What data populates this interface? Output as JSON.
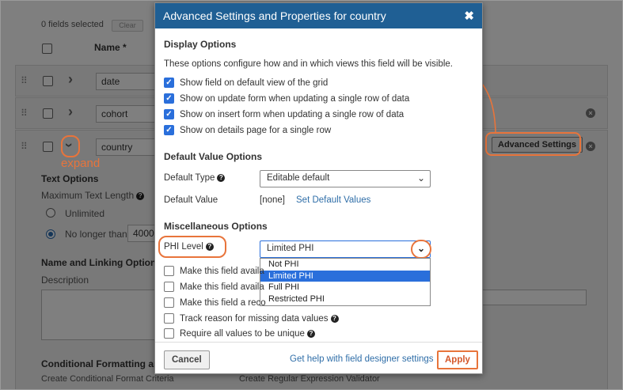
{
  "background": {
    "fields_selected": "0 fields selected",
    "clear_label": "Clear",
    "name_header": "Name *",
    "rows": [
      {
        "name": "date"
      },
      {
        "name": "cohort"
      },
      {
        "name": "country"
      }
    ],
    "advanced_settings_label": "Advanced Settings",
    "text_options_title": "Text Options",
    "max_text_length_label": "Maximum Text Length",
    "unlimited_label": "Unlimited",
    "no_longer_than_label": "No longer than",
    "no_longer_than_value": "4000",
    "name_linking_title": "Name and Linking Options",
    "description_label": "Description",
    "conditional_title": "Conditional Formatting and V",
    "create_conditional_label": "Create Conditional Format Criteria",
    "create_regex_label": "Create Regular Expression Validator"
  },
  "annotation": {
    "expand_label": "expand",
    "color": "#e8743b"
  },
  "modal": {
    "title": "Advanced Settings and Properties for country",
    "close_icon": "✖",
    "display_options": {
      "title": "Display Options",
      "description": "These options configure how and in which views this field will be visible.",
      "checkboxes": [
        {
          "label": "Show field on default view of the grid",
          "checked": true
        },
        {
          "label": "Show on update form when updating a single row of data",
          "checked": true
        },
        {
          "label": "Show on insert form when updating a single row of data",
          "checked": true
        },
        {
          "label": "Show on details page for a single row",
          "checked": true
        }
      ]
    },
    "default_value_options": {
      "title": "Default Value Options",
      "default_type_label": "Default Type",
      "default_type_value": "Editable default",
      "default_value_label": "Default Value",
      "default_value_value": "[none]",
      "set_default_link": "Set Default Values"
    },
    "misc_options": {
      "title": "Miscellaneous Options",
      "phi_label": "PHI Level",
      "phi_value": "Limited PHI",
      "phi_options": [
        "Not PHI",
        "Limited PHI",
        "Full PHI",
        "Restricted PHI"
      ],
      "checkboxes": [
        {
          "label": "Make this field availa",
          "checked": false
        },
        {
          "label": "Make this field availa",
          "checked": false
        },
        {
          "label": "Make this field a reco",
          "checked": false
        },
        {
          "label": "Track reason for missing data values",
          "checked": false
        },
        {
          "label": "Require all values to be unique",
          "checked": false
        }
      ]
    },
    "footer": {
      "cancel_label": "Cancel",
      "help_link": "Get help with field designer settings",
      "apply_label": "Apply"
    }
  }
}
